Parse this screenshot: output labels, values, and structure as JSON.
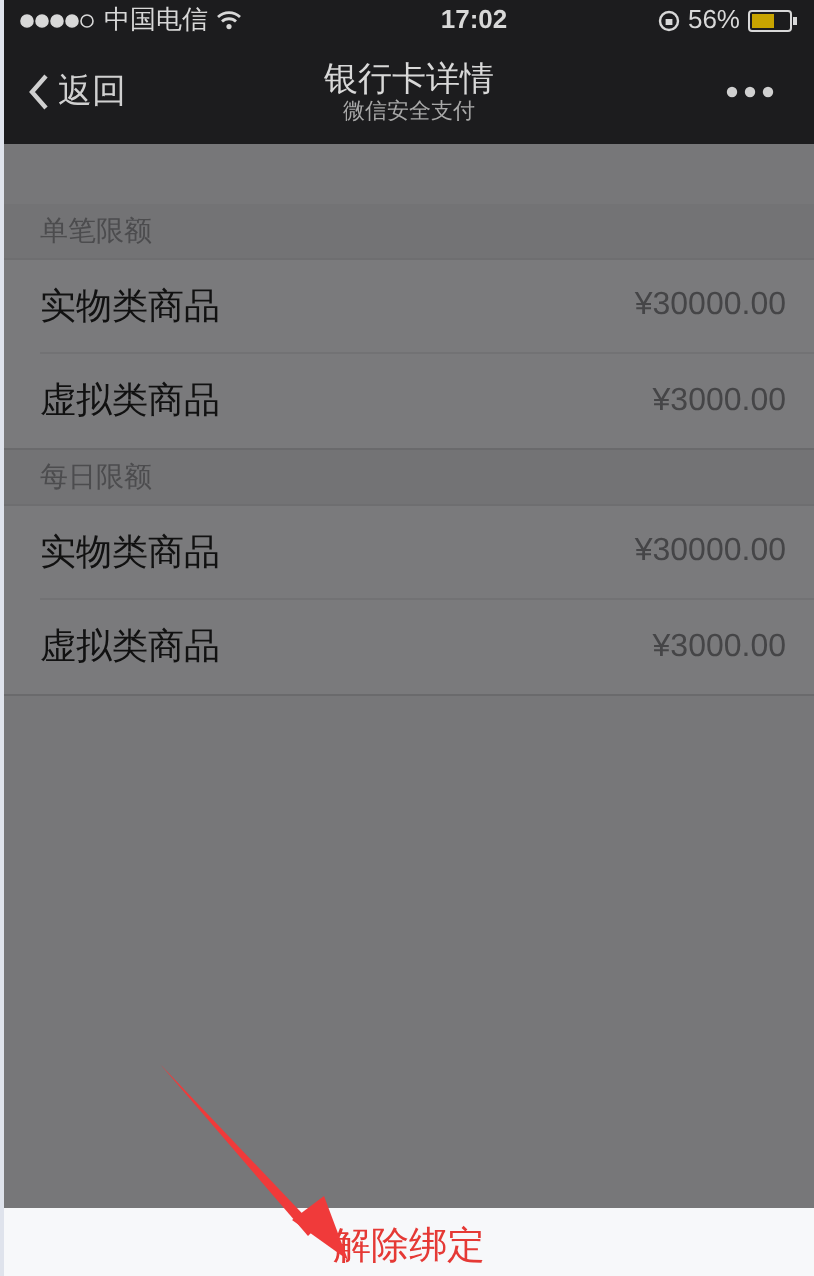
{
  "status_bar": {
    "carrier": "中国电信",
    "time": "17:02",
    "battery": "56%"
  },
  "nav_bar": {
    "back": "返回",
    "title": "银行卡详情",
    "subtitle": "微信安全支付"
  },
  "sections": [
    {
      "header": "单笔限额",
      "rows": [
        {
          "label": "实物类商品",
          "amount": "¥30000.00"
        },
        {
          "label": "虚拟类商品",
          "amount": "¥3000.00"
        }
      ]
    },
    {
      "header": "每日限额",
      "rows": [
        {
          "label": "实物类商品",
          "amount": "¥30000.00"
        },
        {
          "label": "虚拟类商品",
          "amount": "¥3000.00"
        }
      ]
    }
  ],
  "action_sheet": {
    "button": "解除绑定"
  }
}
